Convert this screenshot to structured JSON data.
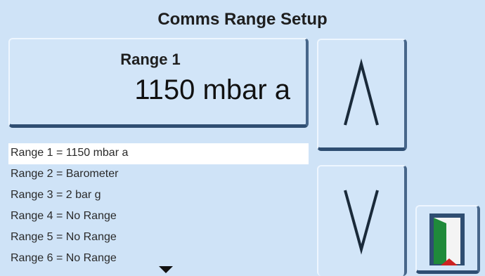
{
  "header": {
    "title": "Comms Range Setup"
  },
  "current_range": {
    "name": "Range 1",
    "value": "1150 mbar a"
  },
  "ranges": [
    {
      "label": "Range 1 = 1150 mbar a",
      "selected": true
    },
    {
      "label": "Range 2 = Barometer",
      "selected": false
    },
    {
      "label": "Range 3 = 2 bar g",
      "selected": false
    },
    {
      "label": "Range 4 = No Range",
      "selected": false
    },
    {
      "label": "Range 5 = No Range",
      "selected": false
    },
    {
      "label": "Range 6 = No Range",
      "selected": false
    }
  ],
  "icons": {
    "up": "chevron-up-icon",
    "down": "chevron-down-icon",
    "exit": "exit-door-icon",
    "more": "scroll-down-arrow-icon"
  },
  "colors": {
    "background": "#cfe3f7",
    "button_face": "#d2e5f8",
    "button_shadow": "#2f4e72",
    "selected_row": "#ffffff",
    "door_green": "#1f8a3a",
    "door_red": "#cc2222"
  }
}
